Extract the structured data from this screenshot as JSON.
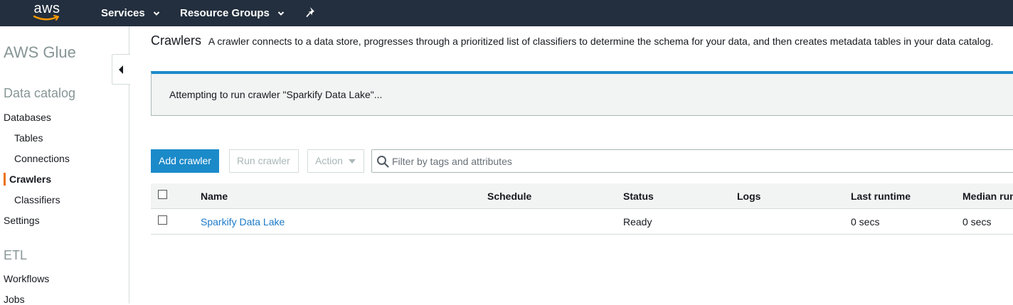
{
  "topnav": {
    "logo_text": "aws",
    "services_label": "Services",
    "resource_groups_label": "Resource Groups",
    "pin_icon": "pin-icon"
  },
  "sidebar": {
    "title": "AWS Glue",
    "sections": {
      "data_catalog": "Data catalog",
      "etl": "ETL"
    },
    "items": {
      "databases": "Databases",
      "tables": "Tables",
      "connections": "Connections",
      "crawlers": "Crawlers",
      "classifiers": "Classifiers",
      "settings": "Settings",
      "workflows": "Workflows",
      "jobs": "Jobs"
    },
    "active_item": "crawlers",
    "active_color": "#ec7211"
  },
  "page": {
    "title": "Crawlers",
    "description": "A crawler connects to a data store, progresses through a prioritized list of classifiers to determine the schema for your data, and then creates metadata tables in your data catalog."
  },
  "flash": {
    "message": "Attempting to run crawler \"Sparkify Data Lake\"...",
    "accent_color": "#1b8ac9"
  },
  "toolbar": {
    "add_crawler_label": "Add crawler",
    "run_crawler_label": "Run crawler",
    "action_label": "Action",
    "search_placeholder": "Filter by tags and attributes"
  },
  "table": {
    "columns": {
      "name": "Name",
      "schedule": "Schedule",
      "status": "Status",
      "logs": "Logs",
      "last_runtime": "Last runtime",
      "median_runtime": "Median runtime"
    },
    "rows": [
      {
        "name": "Sparkify Data Lake",
        "schedule": "",
        "status": "Ready",
        "logs": "",
        "last_runtime": "0 secs",
        "median_runtime": "0 secs"
      }
    ]
  },
  "colors": {
    "topnav_bg": "#232f3e",
    "primary": "#1b8ac9",
    "link": "#1b7ac9"
  }
}
